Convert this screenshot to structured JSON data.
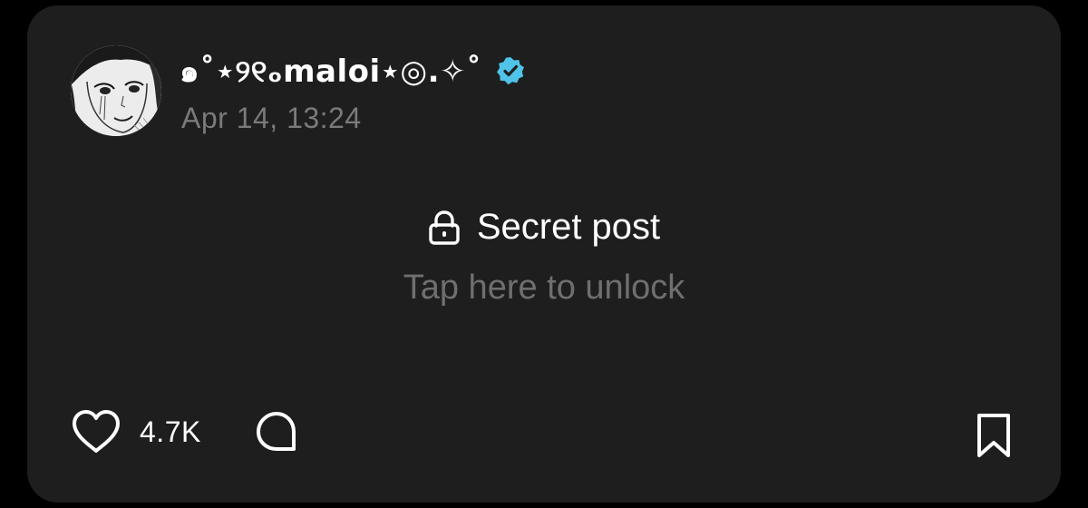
{
  "post": {
    "username": "๑˚⋆୨୧ₒmaloi⋆◎.✧˚",
    "verified": true,
    "timestamp": "Apr 14, 13:24",
    "locked": {
      "title": "Secret post",
      "subtitle": "Tap here to unlock",
      "icon": "lock-icon"
    },
    "actions": {
      "like_icon": "heart-icon",
      "like_count": "4.7K",
      "comment_icon": "comment-bubble-icon",
      "bookmark_icon": "bookmark-icon"
    }
  },
  "colors": {
    "card_background": "#1e1e1e",
    "page_background": "#000000",
    "primary_text": "#ffffff",
    "secondary_text": "#7a7a7a",
    "verified_badge": "#4fc3e8"
  }
}
